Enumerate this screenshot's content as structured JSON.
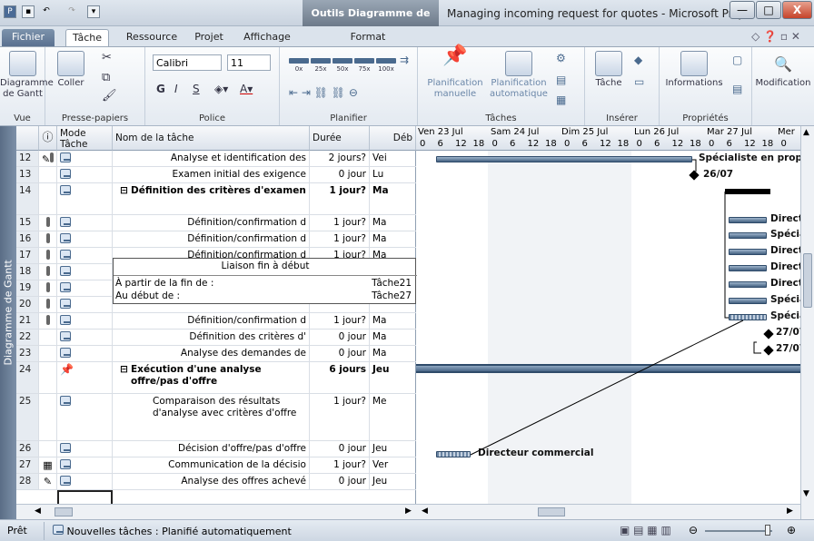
{
  "title": {
    "context_tab": "Outils Diagramme de Gantt",
    "window_title": "Managing incoming request for quotes - Microsoft Proj...",
    "controls": {
      "minimize": "—",
      "maximize": "□",
      "close": "X"
    }
  },
  "tabs": [
    {
      "label": "Fichier"
    },
    {
      "label": "Tâche"
    },
    {
      "label": "Ressource"
    },
    {
      "label": "Projet"
    },
    {
      "label": "Affichage"
    },
    {
      "label": "Format"
    }
  ],
  "ribbon": {
    "vue": {
      "button": "Diagramme de Gantt",
      "label": "Vue"
    },
    "presse_papiers": {
      "paste": "Coller",
      "label": "Presse-papiers"
    },
    "police": {
      "font": "Calibri",
      "size": "11",
      "bold": "G",
      "italic": "I",
      "underline": "S",
      "label": "Police"
    },
    "planifier": {
      "label": "Planifier",
      "pcts": [
        "0x",
        "25x",
        "50x",
        "75x",
        "100x"
      ]
    },
    "taches": {
      "manual": "Planification manuelle",
      "auto": "Planification automatique",
      "label": "Tâches"
    },
    "inserer": {
      "task": "Tâche",
      "label": "Insérer"
    },
    "proprietes": {
      "info": "Informations",
      "label": "Propriétés"
    },
    "modification": {
      "label": "Modification"
    }
  },
  "sidebar_label": "Diagramme de Gantt",
  "table": {
    "headers": {
      "info": "ⓘ",
      "mode": "Mode Tâche",
      "name": "Nom de la tâche",
      "duration": "Durée",
      "start": "Déb"
    },
    "rows": [
      {
        "id": "12",
        "info": "note",
        "res": true,
        "name": "Analyse et identification des",
        "duration": "2 jours?",
        "start": "Vei"
      },
      {
        "id": "13",
        "info": "",
        "res": false,
        "name": "Examen initial des exigence",
        "duration": "0 jour",
        "start": "Lu"
      },
      {
        "id": "14",
        "info": "",
        "res": false,
        "name": "Définition des critères d'examen",
        "duration": "1 jour?",
        "start": "Ma",
        "summary": true
      },
      {
        "id": "15",
        "info": "",
        "res": true,
        "name": "Définition/confirmation d",
        "duration": "1 jour?",
        "start": "Ma"
      },
      {
        "id": "16",
        "info": "",
        "res": true,
        "name": "Définition/confirmation d",
        "duration": "1 jour?",
        "start": "Ma"
      },
      {
        "id": "17",
        "info": "",
        "res": true,
        "name": "Définition/confirmation d",
        "duration": "1 jour?",
        "start": "Ma"
      },
      {
        "id": "18",
        "info": "",
        "res": true,
        "name": "",
        "duration": "",
        "start": ""
      },
      {
        "id": "19",
        "info": "",
        "res": true,
        "name": "",
        "duration": "",
        "start": ""
      },
      {
        "id": "20",
        "info": "",
        "res": true,
        "name": "",
        "duration": "",
        "start": ""
      },
      {
        "id": "21",
        "info": "",
        "res": true,
        "name": "Définition/confirmation d",
        "duration": "1 jour?",
        "start": "Ma"
      },
      {
        "id": "22",
        "info": "",
        "res": false,
        "name": "Définition des critères d'",
        "duration": "0 jour",
        "start": "Ma"
      },
      {
        "id": "23",
        "info": "",
        "res": false,
        "name": "Analyse des demandes de",
        "duration": "0 jour",
        "start": "Ma"
      },
      {
        "id": "24",
        "info": "",
        "res": false,
        "name": "Exécution d'une analyse offre/pas d'offre",
        "duration": "6 jours",
        "start": "Jeu",
        "summary": true,
        "manual": true
      },
      {
        "id": "25",
        "info": "",
        "res": false,
        "name": "Comparaison des résultats d'analyse avec critères d'offre",
        "duration": "1 jour?",
        "start": "Me",
        "wrap": true
      },
      {
        "id": "26",
        "info": "",
        "res": false,
        "name": "Décision d'offre/pas d'offre",
        "duration": "0 jour",
        "start": "Jeu"
      },
      {
        "id": "27",
        "info": "cal",
        "res": false,
        "name": "Communication de la décisio",
        "duration": "1 jour?",
        "start": "Ver"
      },
      {
        "id": "28",
        "info": "note",
        "res": false,
        "name": "Analyse des offres achevé",
        "duration": "0 jour",
        "start": "Jeu"
      }
    ]
  },
  "tooltip": {
    "title": "Liaison fin à début",
    "from_label": "À partir de la fin de :",
    "from_value": "Tâche21",
    "to_label": "Au début de :",
    "to_value": "Tâche27"
  },
  "gantt": {
    "days": [
      "Ven 23 Jul",
      "Sam 24 Jul",
      "Dim 25 Jul",
      "Lun 26 Jul",
      "Mar 27 Jul",
      "Mer"
    ],
    "hours": [
      "0",
      "6",
      "12",
      "18"
    ],
    "labels": {
      "r12": "Spécialiste en propos",
      "r13": "26/07",
      "r15": "Direct",
      "r16": "Spécia",
      "r17": "Direct",
      "r18": "Direct",
      "r19": "Direct",
      "r20": "Spécia",
      "r21": "Spécia",
      "r22": "27/07",
      "r23": "27/07",
      "r27": "Directeur commercial"
    }
  },
  "status": {
    "ready": "Prêt",
    "new_tasks": "Nouvelles tâches : Planifié automatiquement"
  }
}
